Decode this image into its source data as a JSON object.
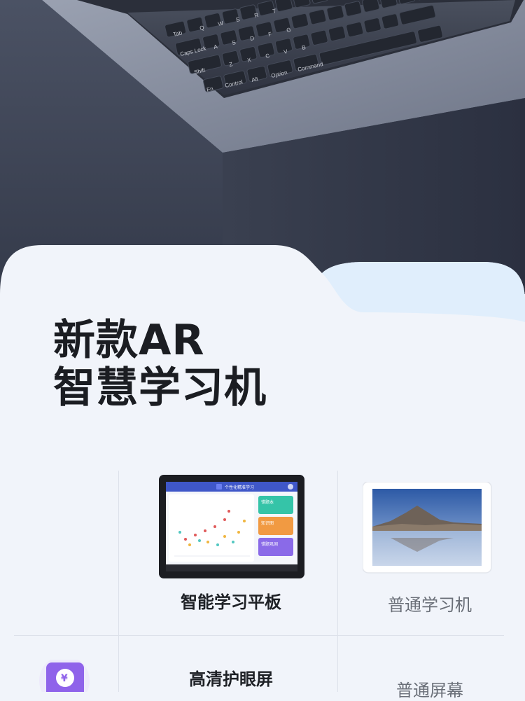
{
  "hero": {
    "image": "keyboard-on-dark-pedestal",
    "keyboard_keys": [
      "Tab",
      "Q",
      "W",
      "E",
      "R",
      "T",
      "Caps Lock",
      "A",
      "S",
      "D",
      "F",
      "G",
      "Shift",
      "Z",
      "X",
      "C",
      "V",
      "B",
      "Fn",
      "Control",
      "Alt",
      "Option",
      "Command"
    ]
  },
  "headline": {
    "line1": "新款AR",
    "line2": "智慧学习机"
  },
  "comparison": {
    "columns": [
      {
        "label": "智能学习平板",
        "image": "smart-tablet"
      },
      {
        "label": "普通学习机",
        "image": "ordinary-tablet"
      }
    ],
    "rows": [
      {
        "icon": "yen-icon",
        "feature": "高清护眼屏",
        "ordinary": "普通屏幕"
      }
    ]
  },
  "tablet_screen": {
    "app_title": "个性化精准学习",
    "cards": [
      "错题本",
      "知识图",
      "错题巩固"
    ]
  },
  "colors": {
    "hero_dark": "#3d4456",
    "panel_bg": "#f1f4fa",
    "panel_accent": "#dfeefc",
    "text_dark": "#1b1d22",
    "text_gray": "#6a6f78",
    "badge_purple": "#8f63ea"
  }
}
